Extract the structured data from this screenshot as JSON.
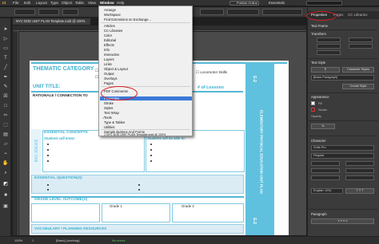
{
  "menubar": {
    "items": [
      "File",
      "Edit",
      "Layout",
      "Type",
      "Object",
      "Table",
      "View",
      "Window",
      "Help"
    ],
    "publish_label": "Publish Online",
    "workspace": "Essentials"
  },
  "document_tab": "NYC DOE UNIT PLAN Template.indd @ 100%",
  "window_menu": {
    "items": [
      "Arrange",
      "Workspace",
      "Find Extensions on Exchange...",
      "Articles",
      "CC Libraries",
      "Color",
      "Editorial",
      "Effects",
      "Info",
      "Interactive",
      "Layers",
      "Links",
      "Object & Layout",
      "Output",
      "Overlays",
      "Pages",
      "PDF Comments",
      "Properties",
      "Stroke",
      "Styles",
      "Text Wrap",
      "Tools",
      "Type & Tables",
      "Utilities",
      "Sample Buttons And Forms",
      "1 NYC DOE UNIT PLAN Template.indd @ 100%"
    ],
    "highlighted": "Properties"
  },
  "page": {
    "thematic_category": "THEMATIC CATEGORY",
    "check_1": "Safety & Management",
    "check_2": "Rhythm & Educa",
    "locomotor": "Locomotor Skills",
    "unit_title": "UNIT TITLE:",
    "num_lessons": "# of Lessons",
    "rationale": "RATIONALE / CONNECTION TO",
    "big_ideas": "BIG IDEAS",
    "essential_concepts": "ESSENTIAL CONCEPTS",
    "students_will_know": "Students will know:",
    "students_will_be_able": "Students will be able to:",
    "essential_questions": "ESSENTIAL QUESTION(S)",
    "grade_level_outcomes": "GRADE LEVEL OUTCOME(S)",
    "grade_1": "Grade 1",
    "grade_2": "Grade 2",
    "vocabulary": "VOCABULARY / PLANNING RESOURCES",
    "side_label_top": "E-2",
    "side_label_mid": "ELEMENTARY PHYSICAL EDUCATION UNIT PLAN",
    "side_label_bottom": "E-2"
  },
  "panel": {
    "tabs": [
      "Properties",
      "Pages",
      "CC Libraries"
    ],
    "section_text_frame": "Text Frame",
    "section_transform": "Transform",
    "section_text_style": "Text Style",
    "paragraph_style": "[Basic Paragraph]",
    "character_styles_btn": "Character Styles",
    "create_style_btn": "Create Style",
    "section_appearance": "Appearance",
    "fill_label": "Fill",
    "stroke_label": "Stroke",
    "opacity_label": "Opacity",
    "section_character": "Character",
    "font_value": "Sofia Pro",
    "style_value": "Regular",
    "language_value": "English: USA",
    "section_paragraph": "Paragraph"
  },
  "status": {
    "zoom": "100%",
    "page": "1",
    "style": "[Basic] (working)",
    "errors": "No errors"
  }
}
